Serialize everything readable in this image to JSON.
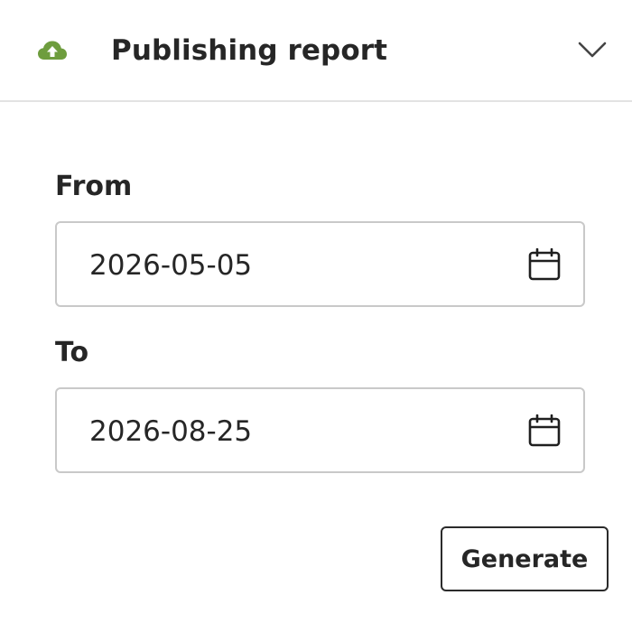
{
  "header": {
    "title": "Publishing report",
    "icon": "cloud-upload-icon",
    "icon_color": "#6e9d3e",
    "toggle_icon": "chevron-down-icon"
  },
  "form": {
    "from": {
      "label": "From",
      "value": "2026-05-05",
      "icon": "calendar-icon"
    },
    "to": {
      "label": "To",
      "value": "2026-08-25",
      "icon": "calendar-icon"
    }
  },
  "actions": {
    "generate_label": "Generate"
  }
}
